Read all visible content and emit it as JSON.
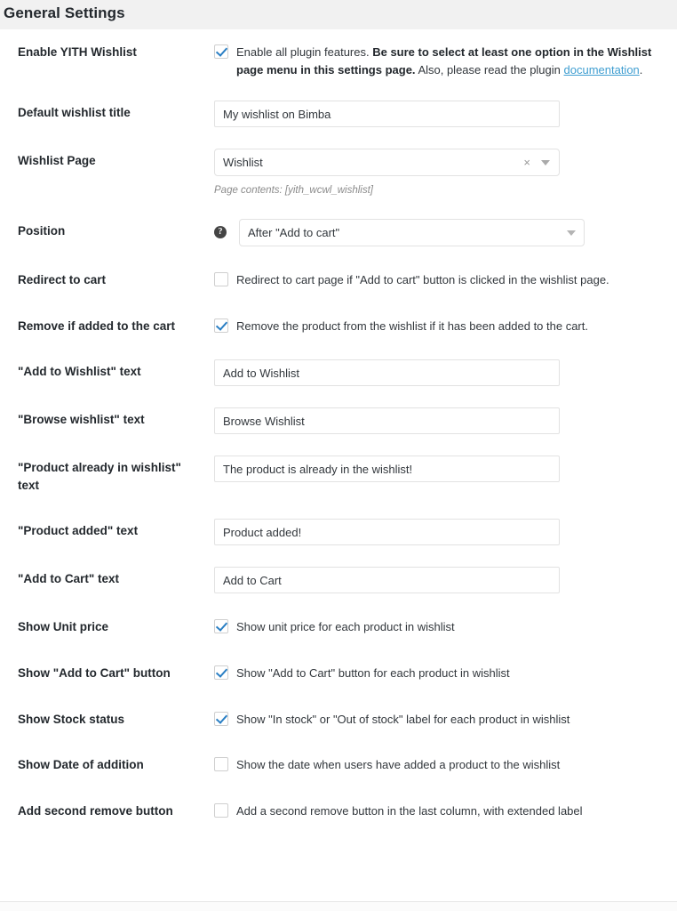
{
  "header": {
    "title": "General Settings"
  },
  "colors": {
    "header_bg": "#f1f1f1",
    "label_text": "#23282d",
    "body_text": "#32373c",
    "link": "#3f9ed1",
    "checkbox_check": "#2a7fc4",
    "input_border": "#e2e2e2",
    "help_icon_bg": "#444444"
  },
  "rows": [
    {
      "label": "Enable YITH Wishlist",
      "type": "checkbox",
      "checked": true,
      "text_parts": [
        {
          "kind": "plain",
          "text": "Enable all plugin features. "
        },
        {
          "kind": "bold",
          "text": "Be sure to select at least one option in the Wishlist page menu in this settings page."
        },
        {
          "kind": "plain",
          "text": " Also, please read the plugin "
        },
        {
          "kind": "link",
          "text": "documentation"
        },
        {
          "kind": "plain",
          "text": "."
        }
      ],
      "full_text": "Enable all plugin features. Be sure to select at least one option in the Wishlist page menu in this settings page. Also, please read the plugin documentation."
    },
    {
      "label": "Default wishlist title",
      "type": "text",
      "value": "My wishlist on Bimba",
      "placeholder": ""
    },
    {
      "label": "Wishlist Page",
      "type": "select2",
      "value": "Wishlist",
      "clear_icon": "close-icon",
      "arrow_icon": "chevron-down-icon",
      "description": "Page contents: [yith_wcwl_wishlist]"
    },
    {
      "label": "Position",
      "type": "select",
      "value": "After \"Add to cart\"",
      "help_icon": "help-icon",
      "help_glyph": "?",
      "arrow_icon": "chevron-down-icon"
    },
    {
      "label": "Redirect to cart",
      "type": "checkbox",
      "checked": false,
      "full_text": "Redirect to cart page if \"Add to cart\" button is clicked in the wishlist page."
    },
    {
      "label": "Remove if added to the cart",
      "type": "checkbox",
      "checked": true,
      "full_text": "Remove the product from the wishlist if it has been added to the cart."
    },
    {
      "label": "\"Add to Wishlist\" text",
      "type": "text",
      "value": "Add to Wishlist",
      "placeholder": ""
    },
    {
      "label": "\"Browse wishlist\" text",
      "type": "text",
      "value": "Browse Wishlist",
      "placeholder": ""
    },
    {
      "label": "\"Product already in wishlist\" text",
      "type": "text",
      "value": "The product is already in the wishlist!",
      "placeholder": ""
    },
    {
      "label": "\"Product added\" text",
      "type": "text",
      "value": "Product added!",
      "placeholder": ""
    },
    {
      "label": "\"Add to Cart\" text",
      "type": "text",
      "value": "Add to Cart",
      "placeholder": ""
    },
    {
      "label": "Show Unit price",
      "type": "checkbox",
      "checked": true,
      "full_text": "Show unit price for each product in wishlist"
    },
    {
      "label": "Show \"Add to Cart\" button",
      "type": "checkbox",
      "checked": true,
      "full_text": "Show \"Add to Cart\" button for each product in wishlist"
    },
    {
      "label": "Show Stock status",
      "type": "checkbox",
      "checked": true,
      "full_text": "Show \"In stock\" or \"Out of stock\" label for each product in wishlist"
    },
    {
      "label": "Show Date of addition",
      "type": "checkbox",
      "checked": false,
      "full_text": "Show the date when users have added a product to the wishlist"
    },
    {
      "label": "Add second remove button",
      "type": "checkbox",
      "checked": false,
      "full_text": "Add a second remove button in the last column, with extended label"
    }
  ]
}
